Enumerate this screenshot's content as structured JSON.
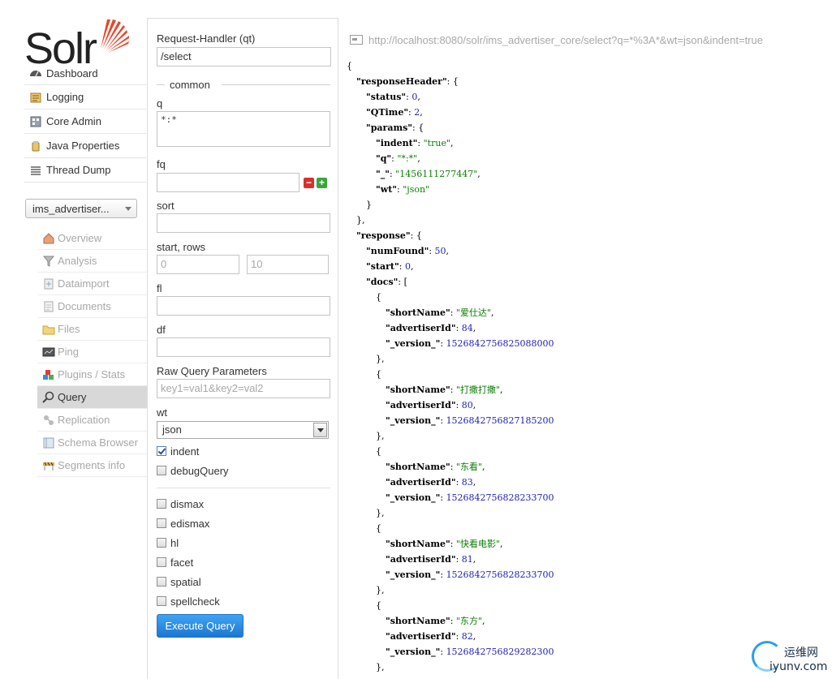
{
  "logo": {
    "text": "Solr"
  },
  "nav": {
    "items": [
      {
        "label": "Dashboard",
        "icon": "dashboard-icon"
      },
      {
        "label": "Logging",
        "icon": "logging-icon"
      },
      {
        "label": "Core Admin",
        "icon": "core-admin-icon"
      },
      {
        "label": "Java Properties",
        "icon": "java-properties-icon"
      },
      {
        "label": "Thread Dump",
        "icon": "thread-dump-icon"
      }
    ],
    "core_selector": "ims_advertiser...",
    "core_items": [
      {
        "label": "Overview",
        "icon": "overview-icon"
      },
      {
        "label": "Analysis",
        "icon": "analysis-icon"
      },
      {
        "label": "Dataimport",
        "icon": "dataimport-icon"
      },
      {
        "label": "Documents",
        "icon": "documents-icon"
      },
      {
        "label": "Files",
        "icon": "files-icon"
      },
      {
        "label": "Ping",
        "icon": "ping-icon"
      },
      {
        "label": "Plugins / Stats",
        "icon": "plugins-icon"
      },
      {
        "label": "Query",
        "icon": "query-icon",
        "active": true
      },
      {
        "label": "Replication",
        "icon": "replication-icon"
      },
      {
        "label": "Schema Browser",
        "icon": "schema-browser-icon"
      },
      {
        "label": "Segments info",
        "icon": "segments-info-icon"
      }
    ]
  },
  "form": {
    "qt_label": "Request-Handler (qt)",
    "qt_value": "/select",
    "common_legend": "common",
    "q_label": "q",
    "q_value": "*:*",
    "fq_label": "fq",
    "fq_value": "",
    "sort_label": "sort",
    "sort_value": "",
    "start_rows_label": "start, rows",
    "start_placeholder": "0",
    "rows_placeholder": "10",
    "fl_label": "fl",
    "fl_value": "",
    "df_label": "df",
    "df_value": "",
    "raw_label": "Raw Query Parameters",
    "raw_placeholder": "key1=val1&key2=val2",
    "wt_label": "wt",
    "wt_value": "json",
    "indent_label": "indent",
    "indent_checked": true,
    "debug_label": "debugQuery",
    "dismax_label": "dismax",
    "edismax_label": "edismax",
    "hl_label": "hl",
    "facet_label": "facet",
    "spatial_label": "spatial",
    "spellcheck_label": "spellcheck",
    "execute_label": "Execute Query"
  },
  "response": {
    "url": "http://localhost:8080/solr/ims_advertiser_core/select?q=*%3A*&wt=json&indent=true",
    "lines": [
      {
        "indent": 0,
        "parts": [
          [
            "p",
            "{"
          ]
        ]
      },
      {
        "indent": 1,
        "parts": [
          [
            "k",
            "\"responseHeader\""
          ],
          [
            "p",
            ": {"
          ]
        ]
      },
      {
        "indent": 2,
        "parts": [
          [
            "k",
            "\"status\""
          ],
          [
            "p",
            ": "
          ],
          [
            "n",
            "0"
          ],
          [
            "p",
            ","
          ]
        ]
      },
      {
        "indent": 2,
        "parts": [
          [
            "k",
            "\"QTime\""
          ],
          [
            "p",
            ": "
          ],
          [
            "n",
            "2"
          ],
          [
            "p",
            ","
          ]
        ]
      },
      {
        "indent": 2,
        "parts": [
          [
            "k",
            "\"params\""
          ],
          [
            "p",
            ": {"
          ]
        ]
      },
      {
        "indent": 3,
        "parts": [
          [
            "k",
            "\"indent\""
          ],
          [
            "p",
            ": "
          ],
          [
            "s",
            "\"true\""
          ],
          [
            "p",
            ","
          ]
        ]
      },
      {
        "indent": 3,
        "parts": [
          [
            "k",
            "\"q\""
          ],
          [
            "p",
            ": "
          ],
          [
            "s",
            "\"*:*\""
          ],
          [
            "p",
            ","
          ]
        ]
      },
      {
        "indent": 3,
        "parts": [
          [
            "k",
            "\"_\""
          ],
          [
            "p",
            ": "
          ],
          [
            "s",
            "\"1456111277447\""
          ],
          [
            "p",
            ","
          ]
        ]
      },
      {
        "indent": 3,
        "parts": [
          [
            "k",
            "\"wt\""
          ],
          [
            "p",
            ": "
          ],
          [
            "s",
            "\"json\""
          ]
        ]
      },
      {
        "indent": 2,
        "parts": [
          [
            "p",
            "}"
          ]
        ]
      },
      {
        "indent": 1,
        "parts": [
          [
            "p",
            "},"
          ]
        ]
      },
      {
        "indent": 1,
        "parts": [
          [
            "k",
            "\"response\""
          ],
          [
            "p",
            ": {"
          ]
        ]
      },
      {
        "indent": 2,
        "parts": [
          [
            "k",
            "\"numFound\""
          ],
          [
            "p",
            ": "
          ],
          [
            "n",
            "50"
          ],
          [
            "p",
            ","
          ]
        ]
      },
      {
        "indent": 2,
        "parts": [
          [
            "k",
            "\"start\""
          ],
          [
            "p",
            ": "
          ],
          [
            "n",
            "0"
          ],
          [
            "p",
            ","
          ]
        ]
      },
      {
        "indent": 2,
        "parts": [
          [
            "k",
            "\"docs\""
          ],
          [
            "p",
            ": ["
          ]
        ]
      },
      {
        "indent": 3,
        "parts": [
          [
            "p",
            "{"
          ]
        ]
      },
      {
        "indent": 4,
        "parts": [
          [
            "k",
            "\"shortName\""
          ],
          [
            "p",
            ": "
          ],
          [
            "s",
            "\"爱仕达\""
          ],
          [
            "p",
            ","
          ]
        ]
      },
      {
        "indent": 4,
        "parts": [
          [
            "k",
            "\"advertiserId\""
          ],
          [
            "p",
            ": "
          ],
          [
            "n",
            "84"
          ],
          [
            "p",
            ","
          ]
        ]
      },
      {
        "indent": 4,
        "parts": [
          [
            "k",
            "\"_version_\""
          ],
          [
            "p",
            ": "
          ],
          [
            "n",
            "1526842756825088000"
          ]
        ]
      },
      {
        "indent": 3,
        "parts": [
          [
            "p",
            "},"
          ]
        ]
      },
      {
        "indent": 3,
        "parts": [
          [
            "p",
            "{"
          ]
        ]
      },
      {
        "indent": 4,
        "parts": [
          [
            "k",
            "\"shortName\""
          ],
          [
            "p",
            ": "
          ],
          [
            "s",
            "\"打撒打撒\""
          ],
          [
            "p",
            ","
          ]
        ]
      },
      {
        "indent": 4,
        "parts": [
          [
            "k",
            "\"advertiserId\""
          ],
          [
            "p",
            ": "
          ],
          [
            "n",
            "80"
          ],
          [
            "p",
            ","
          ]
        ]
      },
      {
        "indent": 4,
        "parts": [
          [
            "k",
            "\"_version_\""
          ],
          [
            "p",
            ": "
          ],
          [
            "n",
            "1526842756827185200"
          ]
        ]
      },
      {
        "indent": 3,
        "parts": [
          [
            "p",
            "},"
          ]
        ]
      },
      {
        "indent": 3,
        "parts": [
          [
            "p",
            "{"
          ]
        ]
      },
      {
        "indent": 4,
        "parts": [
          [
            "k",
            "\"shortName\""
          ],
          [
            "p",
            ": "
          ],
          [
            "s",
            "\"东看\""
          ],
          [
            "p",
            ","
          ]
        ]
      },
      {
        "indent": 4,
        "parts": [
          [
            "k",
            "\"advertiserId\""
          ],
          [
            "p",
            ": "
          ],
          [
            "n",
            "83"
          ],
          [
            "p",
            ","
          ]
        ]
      },
      {
        "indent": 4,
        "parts": [
          [
            "k",
            "\"_version_\""
          ],
          [
            "p",
            ": "
          ],
          [
            "n",
            "1526842756828233700"
          ]
        ]
      },
      {
        "indent": 3,
        "parts": [
          [
            "p",
            "},"
          ]
        ]
      },
      {
        "indent": 3,
        "parts": [
          [
            "p",
            "{"
          ]
        ]
      },
      {
        "indent": 4,
        "parts": [
          [
            "k",
            "\"shortName\""
          ],
          [
            "p",
            ": "
          ],
          [
            "s",
            "\"快看电影\""
          ],
          [
            "p",
            ","
          ]
        ]
      },
      {
        "indent": 4,
        "parts": [
          [
            "k",
            "\"advertiserId\""
          ],
          [
            "p",
            ": "
          ],
          [
            "n",
            "81"
          ],
          [
            "p",
            ","
          ]
        ]
      },
      {
        "indent": 4,
        "parts": [
          [
            "k",
            "\"_version_\""
          ],
          [
            "p",
            ": "
          ],
          [
            "n",
            "1526842756828233700"
          ]
        ]
      },
      {
        "indent": 3,
        "parts": [
          [
            "p",
            "},"
          ]
        ]
      },
      {
        "indent": 3,
        "parts": [
          [
            "p",
            "{"
          ]
        ]
      },
      {
        "indent": 4,
        "parts": [
          [
            "k",
            "\"shortName\""
          ],
          [
            "p",
            ": "
          ],
          [
            "s",
            "\"东方\""
          ],
          [
            "p",
            ","
          ]
        ]
      },
      {
        "indent": 4,
        "parts": [
          [
            "k",
            "\"advertiserId\""
          ],
          [
            "p",
            ": "
          ],
          [
            "n",
            "82"
          ],
          [
            "p",
            ","
          ]
        ]
      },
      {
        "indent": 4,
        "parts": [
          [
            "k",
            "\"_version_\""
          ],
          [
            "p",
            ": "
          ],
          [
            "n",
            "1526842756829282300"
          ]
        ]
      },
      {
        "indent": 3,
        "parts": [
          [
            "p",
            "},"
          ]
        ]
      }
    ]
  },
  "watermark": {
    "cn": "运维网",
    "domain": "iyunv.com"
  },
  "colors": {
    "accent": "#1b77d2",
    "string": "#0a7d00",
    "number": "#1f1fb3",
    "sun": "#e8442a"
  }
}
